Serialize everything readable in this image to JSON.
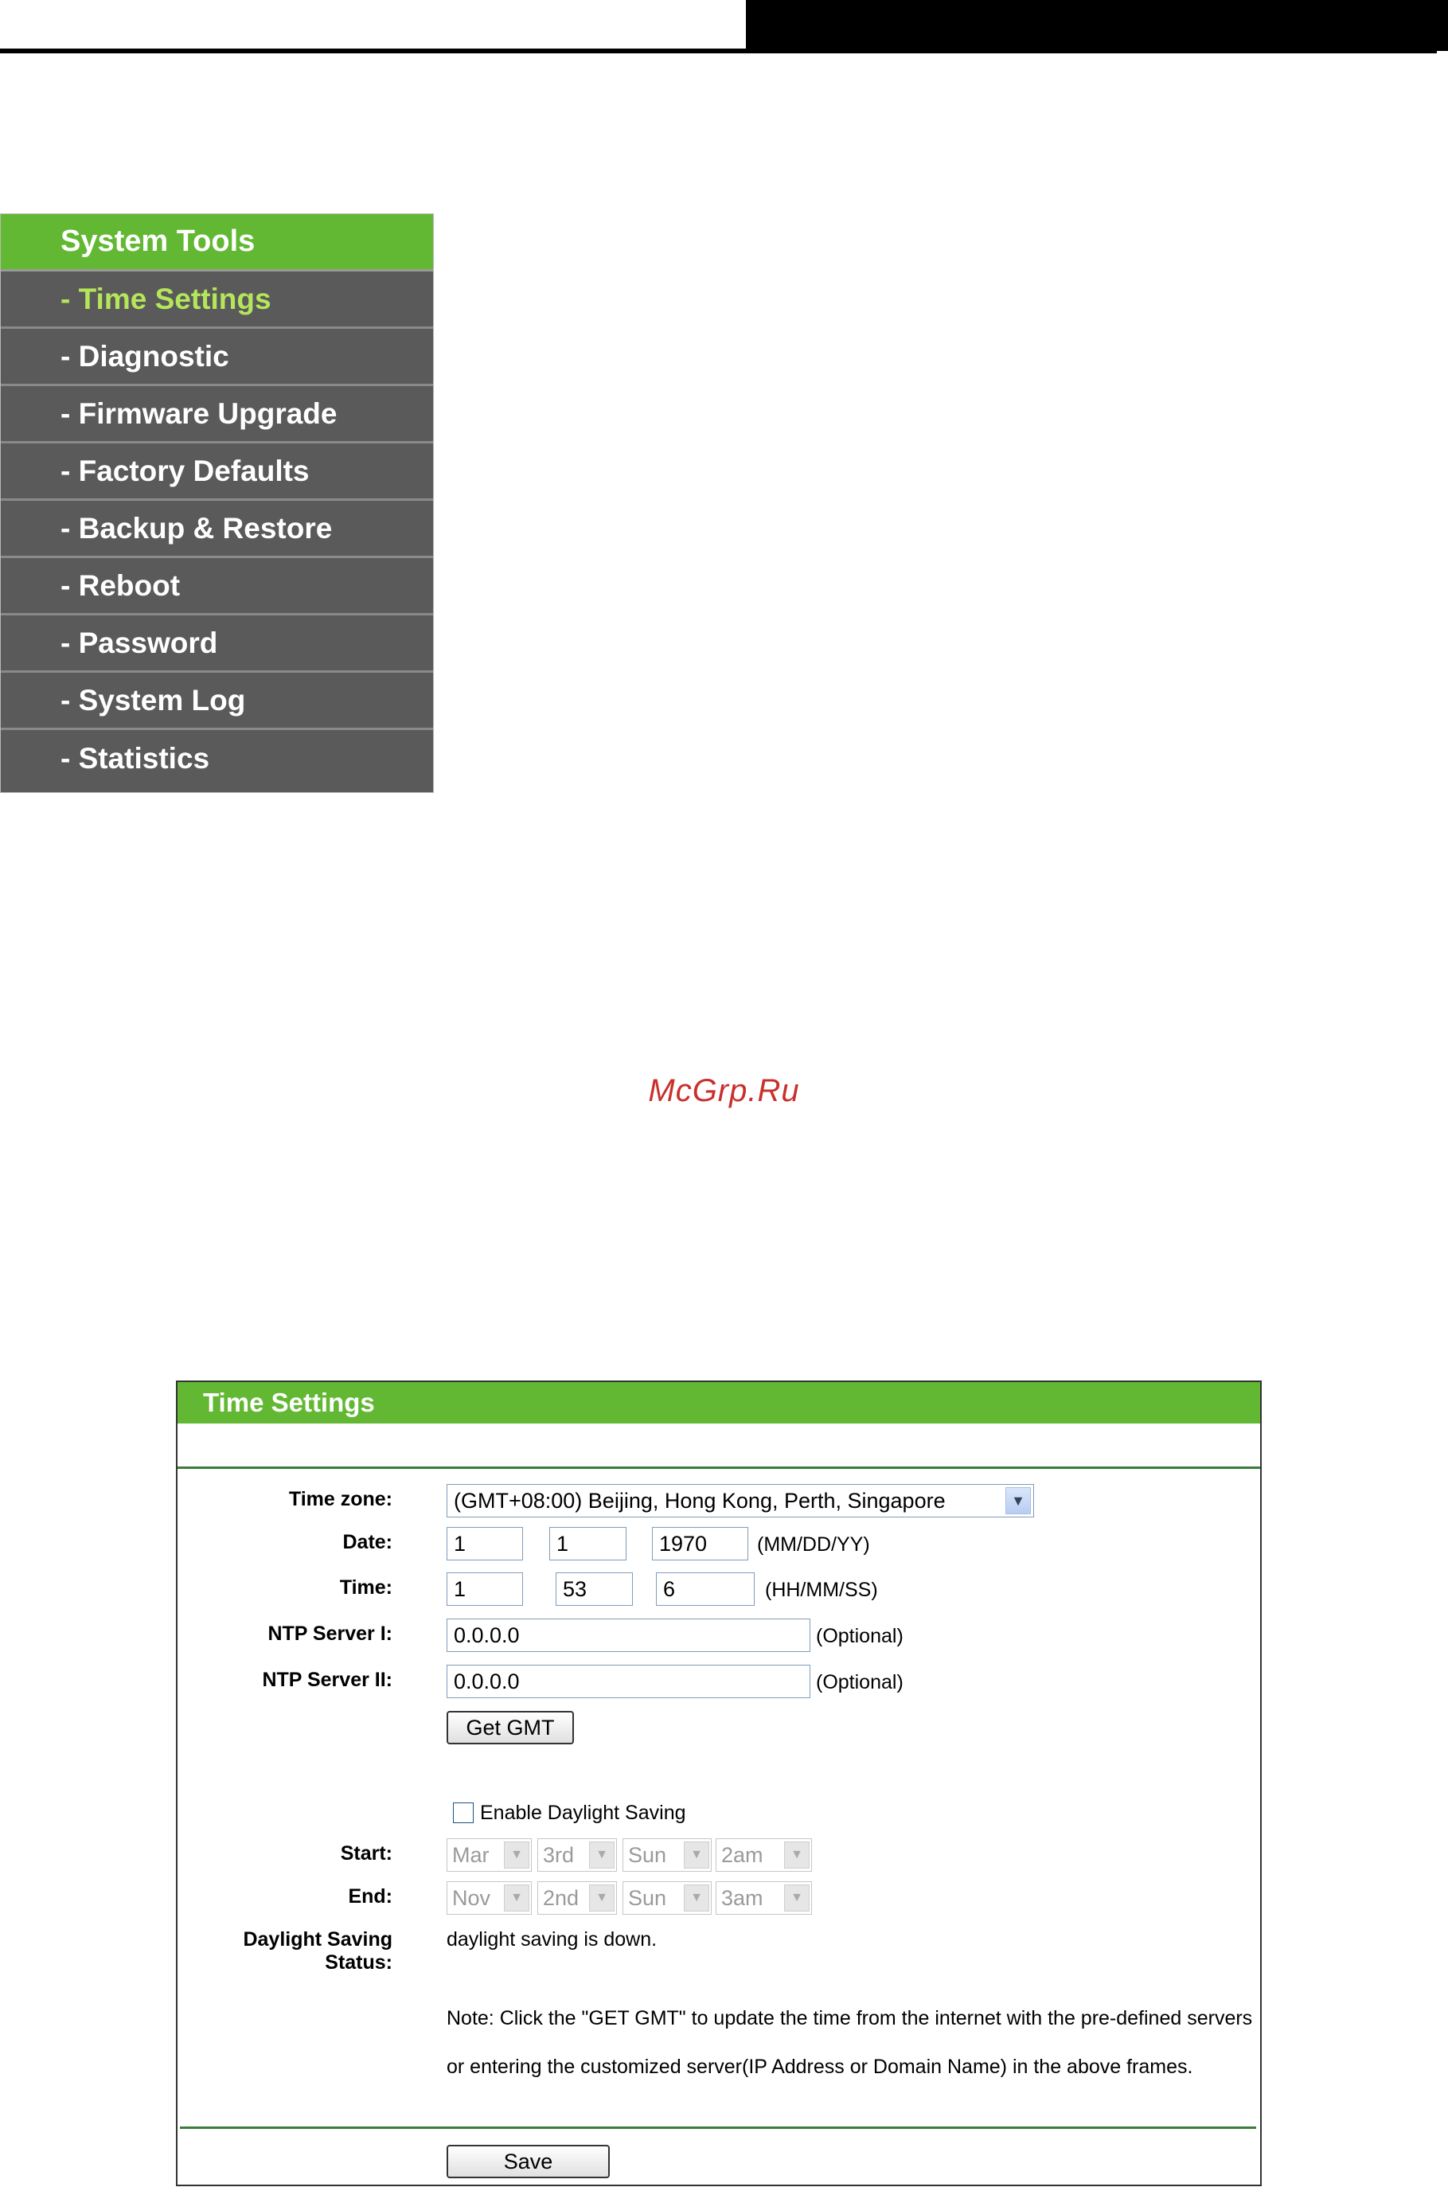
{
  "sidebar": {
    "title": "System Tools",
    "items": [
      {
        "label": "- Time Settings",
        "active": true
      },
      {
        "label": "- Diagnostic",
        "active": false
      },
      {
        "label": "- Firmware Upgrade",
        "active": false
      },
      {
        "label": "- Factory Defaults",
        "active": false
      },
      {
        "label": "- Backup & Restore",
        "active": false
      },
      {
        "label": "- Reboot",
        "active": false
      },
      {
        "label": "- Password",
        "active": false
      },
      {
        "label": "- System Log",
        "active": false
      },
      {
        "label": "- Statistics",
        "active": false
      }
    ]
  },
  "watermark": "McGrp.Ru",
  "panel": {
    "title": "Time Settings",
    "timezone": {
      "label": "Time zone:",
      "value": "(GMT+08:00) Beijing, Hong Kong, Perth, Singapore"
    },
    "date": {
      "label": "Date:",
      "month": "1",
      "day": "1",
      "year": "1970",
      "format": "(MM/DD/YY)"
    },
    "time": {
      "label": "Time:",
      "hour": "1",
      "minute": "53",
      "second": "6",
      "format": "(HH/MM/SS)"
    },
    "ntp1": {
      "label": "NTP Server I:",
      "value": "0.0.0.0",
      "hint": "(Optional)"
    },
    "ntp2": {
      "label": "NTP Server II:",
      "value": "0.0.0.0",
      "hint": "(Optional)"
    },
    "get_gmt_label": "Get GMT",
    "dst_checkbox_label": "Enable Daylight Saving",
    "start": {
      "label": "Start:",
      "month": "Mar",
      "week": "3rd",
      "day": "Sun",
      "hour": "2am"
    },
    "end": {
      "label": "End:",
      "month": "Nov",
      "week": "2nd",
      "day": "Sun",
      "hour": "3am"
    },
    "dst_status": {
      "label": "Daylight Saving Status:",
      "value": "daylight saving is down."
    },
    "note_line1": "Note: Click the \"GET GMT\" to update the time from the internet with the pre-defined servers",
    "note_line2": "or entering the customized server(IP Address or Domain Name) in the above frames.",
    "save_label": "Save"
  }
}
